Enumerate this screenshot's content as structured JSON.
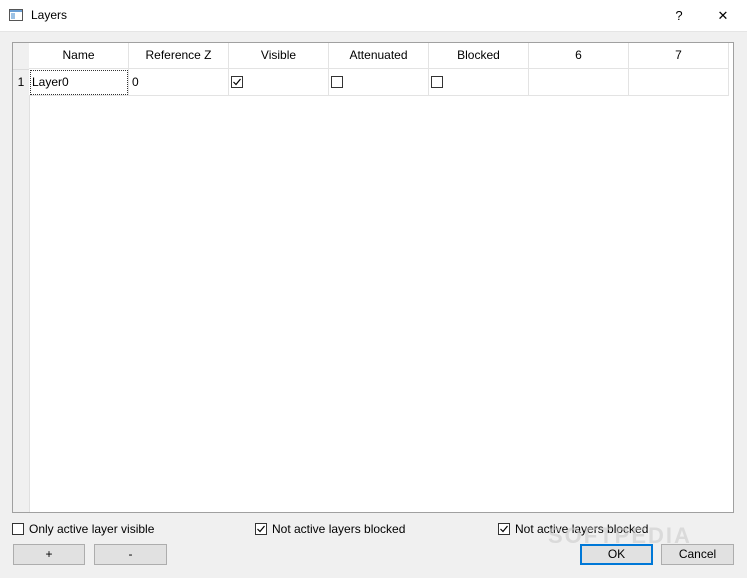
{
  "window": {
    "title": "Layers",
    "help_label": "?",
    "close_label": "✕"
  },
  "table": {
    "columns": [
      "Name",
      "Reference Z",
      "Visible",
      "Attenuated",
      "Blocked",
      "6",
      "7"
    ],
    "rows": [
      {
        "row_number": "1",
        "name": "Layer0",
        "reference_z": "0",
        "visible": true,
        "attenuated": false,
        "blocked": false,
        "col6": "",
        "col7": ""
      }
    ]
  },
  "options": {
    "only_active_visible": {
      "label": "Only active layer visible",
      "checked": false
    },
    "not_active_blocked_1": {
      "label": "Not active layers blocked",
      "checked": true
    },
    "not_active_blocked_2": {
      "label": "Not active layers blocked",
      "checked": true
    }
  },
  "buttons": {
    "add": "+",
    "remove": "-",
    "ok": "OK",
    "cancel": "Cancel"
  },
  "watermark": "SOFTPEDIA"
}
